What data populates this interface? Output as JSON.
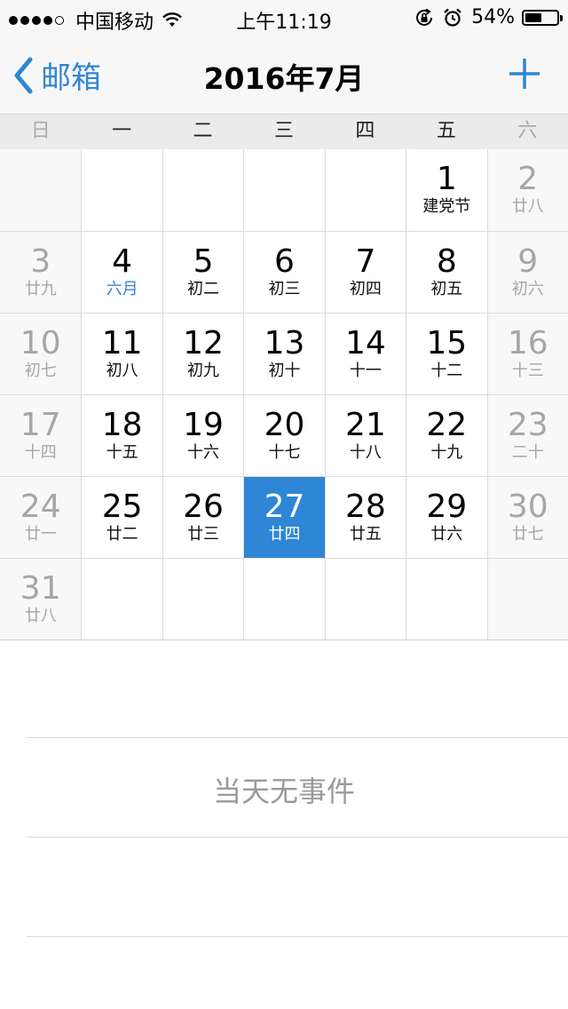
{
  "status_bar": {
    "carrier": "中国移动",
    "time": "上午11:19",
    "battery_percent": "54%",
    "battery_level": 0.54,
    "icons": [
      "signal-dots",
      "wifi-icon",
      "rotation-lock-icon",
      "alarm-icon",
      "battery-icon"
    ]
  },
  "nav": {
    "back_label": "邮箱",
    "title": "2016年7月",
    "add_icon": "plus-icon"
  },
  "weekdays": [
    "日",
    "一",
    "二",
    "三",
    "四",
    "五",
    "六"
  ],
  "calendar": {
    "weeks": [
      [
        {
          "day": "",
          "lunar": ""
        },
        {
          "day": "",
          "lunar": ""
        },
        {
          "day": "",
          "lunar": ""
        },
        {
          "day": "",
          "lunar": ""
        },
        {
          "day": "",
          "lunar": ""
        },
        {
          "day": "1",
          "lunar": "建党节"
        },
        {
          "day": "2",
          "lunar": "廿八"
        }
      ],
      [
        {
          "day": "3",
          "lunar": "廿九"
        },
        {
          "day": "4",
          "lunar": "六月"
        },
        {
          "day": "5",
          "lunar": "初二"
        },
        {
          "day": "6",
          "lunar": "初三"
        },
        {
          "day": "7",
          "lunar": "初四"
        },
        {
          "day": "8",
          "lunar": "初五"
        },
        {
          "day": "9",
          "lunar": "初六"
        }
      ],
      [
        {
          "day": "10",
          "lunar": "初七"
        },
        {
          "day": "11",
          "lunar": "初八"
        },
        {
          "day": "12",
          "lunar": "初九"
        },
        {
          "day": "13",
          "lunar": "初十"
        },
        {
          "day": "14",
          "lunar": "十一"
        },
        {
          "day": "15",
          "lunar": "十二"
        },
        {
          "day": "16",
          "lunar": "十三"
        }
      ],
      [
        {
          "day": "17",
          "lunar": "十四"
        },
        {
          "day": "18",
          "lunar": "十五"
        },
        {
          "day": "19",
          "lunar": "十六"
        },
        {
          "day": "20",
          "lunar": "十七"
        },
        {
          "day": "21",
          "lunar": "十八"
        },
        {
          "day": "22",
          "lunar": "十九"
        },
        {
          "day": "23",
          "lunar": "二十"
        }
      ],
      [
        {
          "day": "24",
          "lunar": "廿一"
        },
        {
          "day": "25",
          "lunar": "廿二"
        },
        {
          "day": "26",
          "lunar": "廿三"
        },
        {
          "day": "27",
          "lunar": "廿四"
        },
        {
          "day": "28",
          "lunar": "廿五"
        },
        {
          "day": "29",
          "lunar": "廿六"
        },
        {
          "day": "30",
          "lunar": "廿七"
        }
      ],
      [
        {
          "day": "31",
          "lunar": "廿八"
        },
        {
          "day": "",
          "lunar": ""
        },
        {
          "day": "",
          "lunar": ""
        },
        {
          "day": "",
          "lunar": ""
        },
        {
          "day": "",
          "lunar": ""
        },
        {
          "day": "",
          "lunar": ""
        },
        {
          "day": "",
          "lunar": ""
        }
      ]
    ],
    "selected_day": "27",
    "highlight_lunar_day": "4"
  },
  "events": {
    "empty_message": "当天无事件"
  },
  "colors": {
    "accent": "#2f86d6",
    "weekend_text": "#a6a6a6",
    "bar_background": "#f7f7f7"
  }
}
